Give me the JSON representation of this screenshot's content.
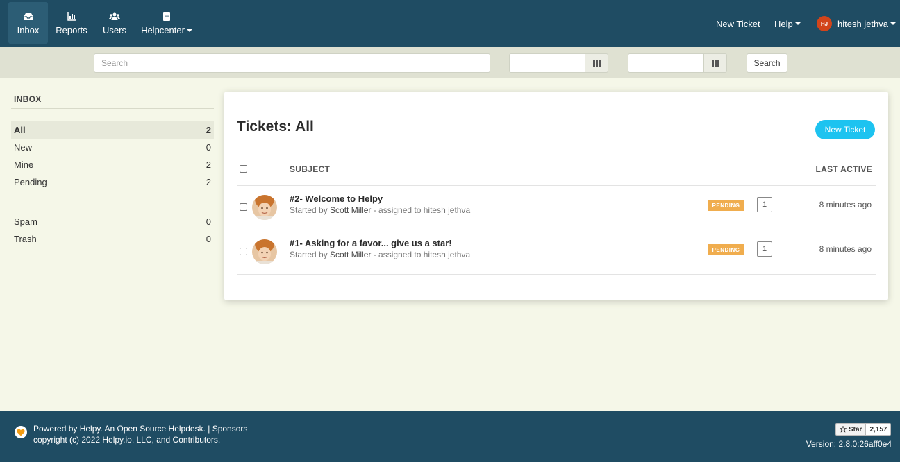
{
  "nav": {
    "items": [
      {
        "label": "Inbox",
        "icon": "inbox-icon"
      },
      {
        "label": "Reports",
        "icon": "chart-icon"
      },
      {
        "label": "Users",
        "icon": "users-icon"
      },
      {
        "label": "Helpcenter",
        "icon": "book-icon"
      }
    ],
    "new_ticket": "New Ticket",
    "help": "Help",
    "user_initials": "HJ",
    "user_name": "hitesh jethva"
  },
  "search": {
    "placeholder": "Search",
    "button": "Search"
  },
  "sidebar": {
    "heading": "INBOX",
    "items": [
      {
        "label": "All",
        "count": "2"
      },
      {
        "label": "New",
        "count": "0"
      },
      {
        "label": "Mine",
        "count": "2"
      },
      {
        "label": "Pending",
        "count": "2"
      },
      {
        "label": "Spam",
        "count": "0"
      },
      {
        "label": "Trash",
        "count": "0"
      }
    ]
  },
  "main": {
    "title": "Tickets: All",
    "new_ticket_button": "New Ticket",
    "columns": {
      "subject": "SUBJECT",
      "last_active": "LAST ACTIVE"
    },
    "tickets": [
      {
        "subject": "#2- Welcome to Helpy",
        "started_prefix": "Started by ",
        "started_by": "Scott Miller",
        "assigned": " - assigned to hitesh jethva",
        "status": "PENDING",
        "count": "1",
        "last_active": "8 minutes ago"
      },
      {
        "subject": "#1- Asking for a favor... give us a star!",
        "started_prefix": "Started by ",
        "started_by": "Scott Miller",
        "assigned": " - assigned to hitesh jethva",
        "status": "PENDING",
        "count": "1",
        "last_active": "8 minutes ago"
      }
    ]
  },
  "footer": {
    "powered": "Powered by Helpy. An Open Source Helpdesk. | Sponsors",
    "copyright": "copyright (c) 2022 Helpy.io, LLC, and Contributors.",
    "star_label": "Star",
    "star_count": "2,157",
    "version": "Version: 2.8.0:26aff0e4"
  },
  "colors": {
    "nav_bg": "#1f4c63",
    "accent": "#1dc3f0",
    "pending": "#f0ad4e"
  }
}
